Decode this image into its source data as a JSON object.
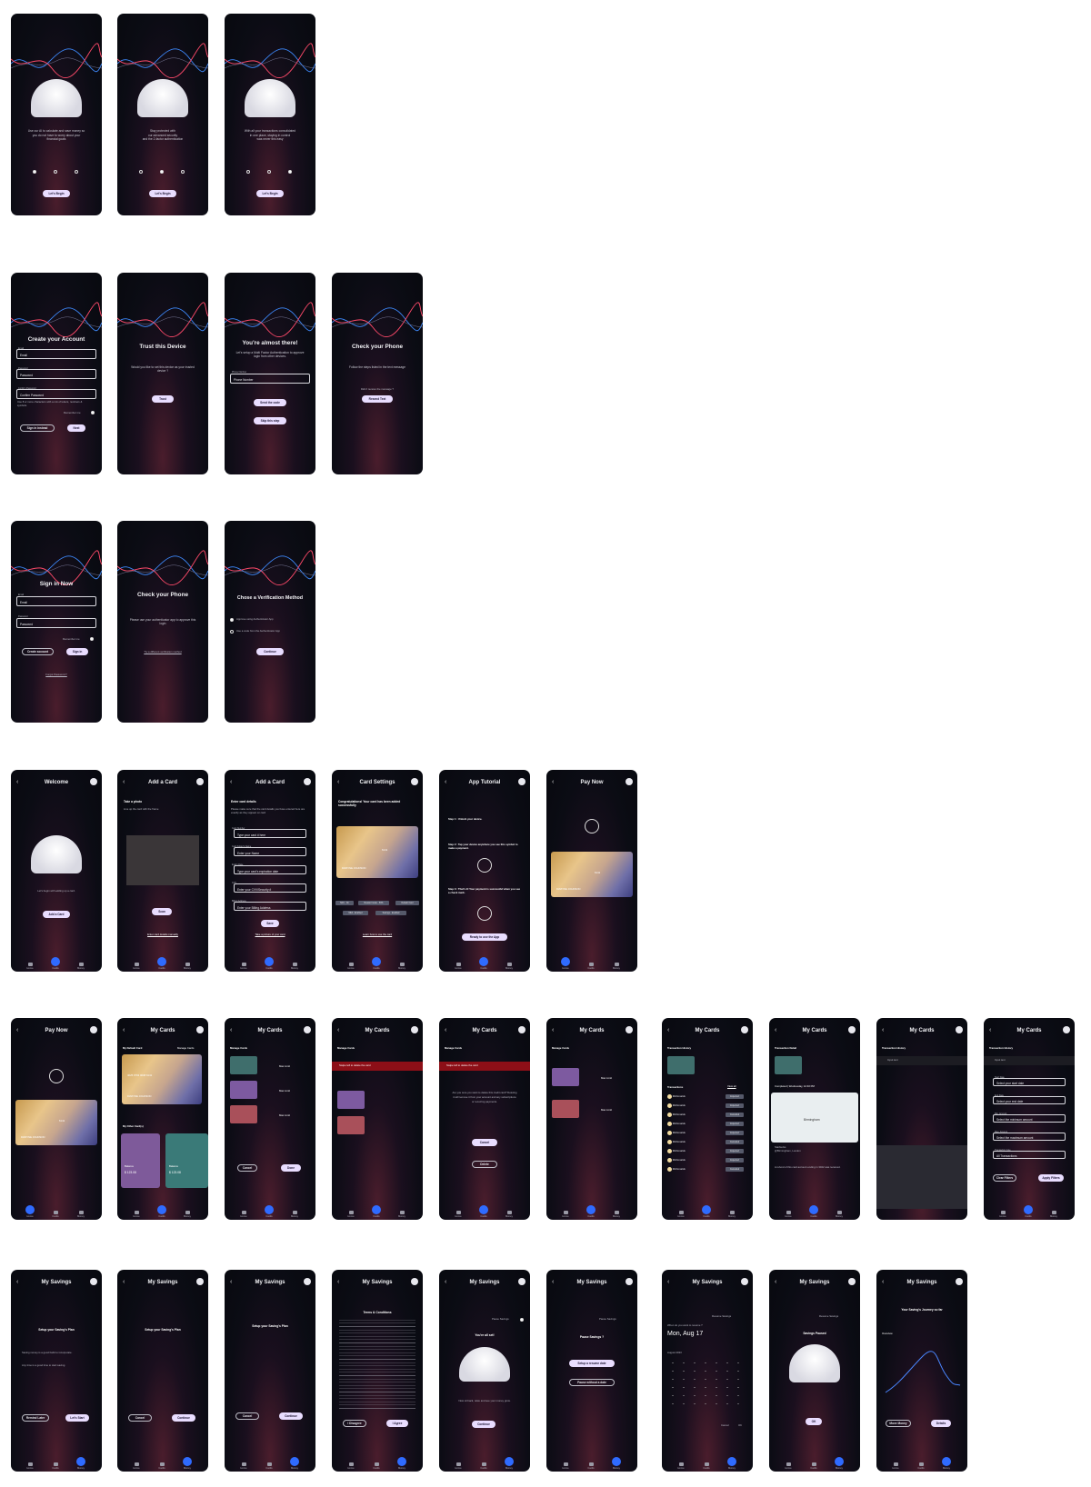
{
  "onboarding": [
    {
      "lines": [
        "Use our AI to calculate and save money so",
        "you do not have to worry about your",
        "financial goals"
      ],
      "active": 0,
      "button": "Let's Begin"
    },
    {
      "lines": [
        "Stay protected with",
        "our advanced security",
        "and the 2-factor authentication"
      ],
      "active": 1,
      "button": "Let's Begin"
    },
    {
      "lines": [
        "With all your transactions consolidated",
        "in one place, staying in control",
        "was never this easy"
      ],
      "active": 2,
      "button": "Let's Begin"
    }
  ],
  "create_account": {
    "title": "Create your Account",
    "email_label": "Email",
    "email": "Email",
    "password_label": "Password",
    "password": "Password",
    "confirm_label": "Confirm Password",
    "confirm": "Confirm Password",
    "hint": "Use 8 or more characters with a mix of letters, numbers & symbols",
    "remember": "Remember me",
    "signin_button": "Sign in instead",
    "next_button": "Next"
  },
  "trust_device": {
    "title": "Trust this Device",
    "text": "Would you like to set this device as your trusted device ?",
    "button": "Trust"
  },
  "almost_there": {
    "title": "You're almost there!",
    "text": "Let's setup a Multi Factor Authentication to approve login from other devices.",
    "phone_label": "Phone Number",
    "phone": "Phone Number",
    "send_button": "Send the code",
    "skip_button": "Skip this step"
  },
  "check_phone_1": {
    "title": "Check your Phone",
    "text": "Follow the steps listed in the text message",
    "sub": "Didn't receive the message ?",
    "button": "Resend Text"
  },
  "sign_in": {
    "title": "Sign in Now",
    "email_label": "Email",
    "email": "Email",
    "password_label": "Password",
    "password": "Password",
    "remember": "Remember me",
    "create_button": "Create account",
    "signin_button": "Sign in",
    "forgot": "Forgot Password ?"
  },
  "check_phone_2": {
    "title": "Check your Phone",
    "text": "Please use your authenticator app to approve this login",
    "link": "Try a different verification method"
  },
  "verification": {
    "title": "Chose a Verification Method",
    "opt1": "Approve using Authenticator App",
    "opt2": "Use a code from the Authenticator App",
    "button": "Continue"
  },
  "nav": {
    "home": "Home",
    "cards": "Cards",
    "money": "Money"
  },
  "welcome": {
    "title": "Welcome",
    "text": "Let's begin with adding up a card.",
    "button": "Add a Card"
  },
  "add_card_photo": {
    "title": "Add a Card",
    "sub": "Take a photo",
    "hint": "Line up the card with the frame",
    "button": "Scan",
    "link": "Enter card details manually"
  },
  "add_card_details": {
    "title": "Add a Card",
    "sub": "Enter card details",
    "hint": "Please make sure that the card details you have entered here are exactly as they appear on card",
    "f1_label": "Card Number",
    "f1": "Type your card # here",
    "f2_label": "Card holder's Name",
    "f2": "Enter your Name",
    "f3_label": "Expiry Date",
    "f3": "Type your card's expiration date",
    "f4_label": "CVV",
    "f4": "Enter your CVV/Security #",
    "f5_label": "Billing Address",
    "f5": "Enter your Billing Address",
    "button": "Save",
    "link": "Take a picture of your card"
  },
  "card_settings": {
    "title": "Card Settings",
    "msg": "Congratulations! Your card has been added successfully",
    "card_digits": "6141",
    "card_name": "DWAYNE   JOHNSON",
    "pills": [
      "NFC - On",
      "Reward mode - 50%",
      "Default Card",
      "MFA - Enabled",
      "Savings - Enabled"
    ],
    "link": "Learn how to use the card"
  },
  "tutorial": {
    "title": "App Tutorial",
    "s1": "Step 1 : Unlock your device.",
    "s2": "Step 2 : Tap your device anywhere you see this symbol to make a payment.",
    "s3": "Step 3 : That's it! Your payment is successful when you see a check mark.",
    "button": "Ready to use the App"
  },
  "pay_now": {
    "title": "Pay Now",
    "card_digits": "6141",
    "card_name": "DWAYNE   JOHNSON"
  },
  "my_cards": {
    "title": "My Cards",
    "default_label": "My Default Card",
    "manage": "Manage Cards",
    "card_number": "4025  9763  0008  6141",
    "card_name": "DWAYNE   JOHNSON",
    "other_label": "My Other Card(s)",
    "balance_label": "Balance",
    "balance": "$ 123.08",
    "manage_title": "Manage Cards",
    "max_limit": "Max Limit",
    "cancel": "Cancel",
    "done": "Done",
    "swipe": "Swipe left to delete the card",
    "delete_q": "Are you sure you want to delete this credit card? Deleting it will remove it from your account and any subscriptions or recurring payments.",
    "delete_btn": "Delete"
  },
  "history": {
    "title": "Transaction History",
    "view_all": "View all",
    "tx_label": "Transactions",
    "merchant": "McDonalds",
    "date": "Friday, Nov 25, 2023",
    "status_a": "Expected",
    "status_b": "Cancelled",
    "detail_title": "Transaction Detail",
    "completed": "Completed | Wednesday, 12:40 PM",
    "city": "Birmingham",
    "shop": "Starbucks",
    "shop_addr": "@Birmingham, London",
    "note": "A refund of this card account ending in 3022 was received.",
    "search_ph": "Input text",
    "start_label": "Start Date",
    "start": "Select your start date",
    "end_label": "End Date",
    "end": "Select your end date",
    "min_label": "Min. Amount",
    "min": "Select the minimum amount",
    "max_label": "Max. Amount",
    "max": "Select the maximum amount",
    "type_label": "Transaction type",
    "type": "All Transactions",
    "clear": "Clear Filters",
    "apply": "Apply Filters"
  },
  "savings": {
    "title": "My Savings",
    "plan_title": "Setup your Saving's Plan",
    "plan_text": "Saving money is a good habit to incorporate.",
    "plan_text2": "Any time is a good time to start saving.",
    "remind": "Remind Later",
    "start": "Let's Start",
    "cancel": "Cancel",
    "continue": "Continue",
    "terms": "Terms & Conditions",
    "disagree": "I Disagree",
    "agree": "I Agree",
    "all_set": "You're all set!",
    "all_set_text": "Now sit back, relax and see your money grow.",
    "pause_label": "Pause Savings",
    "pause_q": "Pause Savings ?",
    "resume_date": "Setup a resume date",
    "without": "Pause without a date",
    "resume_label": "Resume Savings",
    "resume_q": "When do you want to resume ?",
    "date": "Mon, Aug 17",
    "month": "August 2023",
    "ok": "OK",
    "paused": "Savings Paused",
    "journey": "Your Saving's Journey so far",
    "overview": "Overview",
    "more": "Move Money",
    "details": "Details"
  }
}
